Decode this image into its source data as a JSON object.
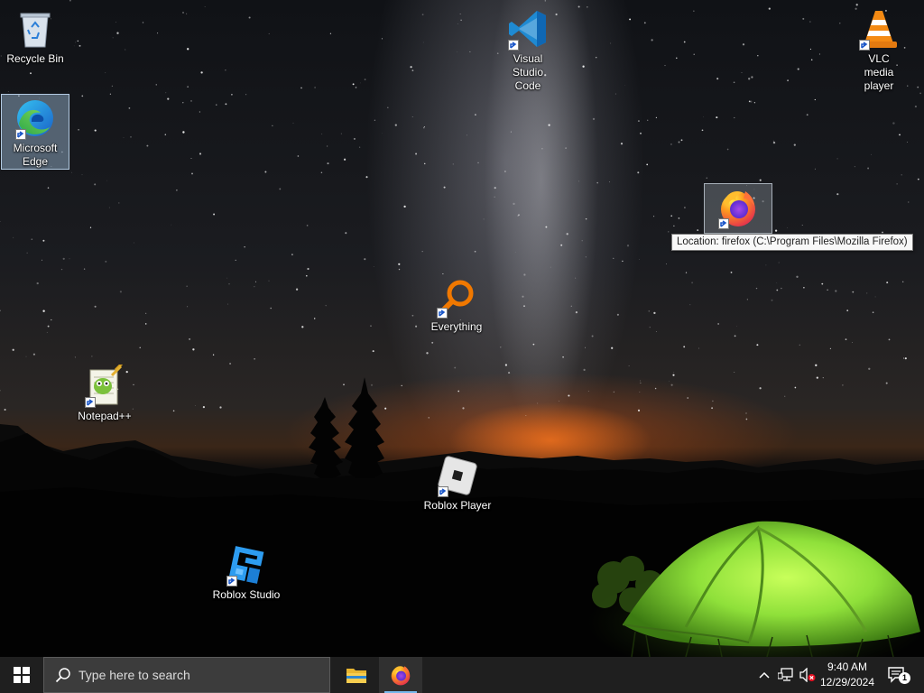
{
  "desktop": {
    "icons": [
      {
        "label": "Recycle Bin",
        "icon": "recycle-bin-icon"
      },
      {
        "label": "Microsoft Edge",
        "icon": "edge-icon"
      },
      {
        "label": "Visual Studio Code",
        "icon": "vscode-icon"
      },
      {
        "label": "VLC media player",
        "icon": "vlc-icon"
      },
      {
        "label": "",
        "icon": "firefox-icon"
      },
      {
        "label": "Everything",
        "icon": "everything-icon"
      },
      {
        "label": "Notepad++",
        "icon": "notepadpp-icon"
      },
      {
        "label": "Roblox Player",
        "icon": "roblox-player-icon"
      },
      {
        "label": "Roblox Studio",
        "icon": "roblox-studio-icon"
      }
    ],
    "tooltip": "Location: firefox (C:\\Program Files\\Mozilla Firefox)"
  },
  "taskbar": {
    "search_placeholder": "Type here to search",
    "pinned": [
      {
        "icon": "file-explorer-icon"
      },
      {
        "icon": "firefox-icon",
        "active": true
      }
    ],
    "tray": {
      "time": "9:40 AM",
      "date": "12/29/2024",
      "notification_count": "1"
    }
  },
  "colors": {
    "taskbar": "#1f1f1f",
    "search_box": "#3c3c3c",
    "accent": "#76b9ed",
    "tent": "#8fe03a"
  }
}
